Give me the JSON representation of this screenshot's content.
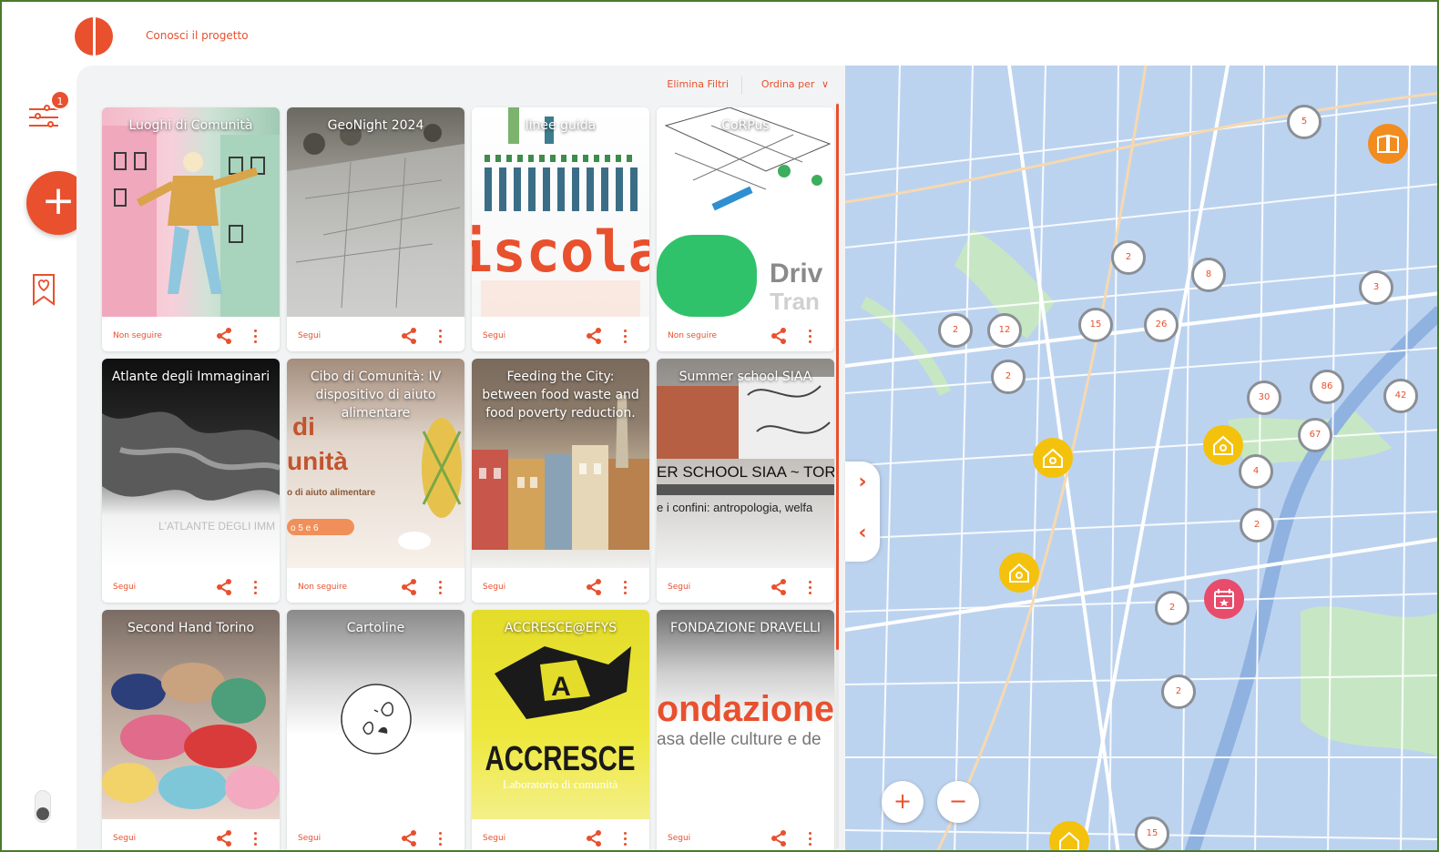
{
  "header": {
    "nav_link": "Conosci il progetto"
  },
  "rail": {
    "filter_badge": "1",
    "add_label": "+"
  },
  "toolbar": {
    "clear_filters": "Elimina Filtri",
    "sort_label": "Ordina per",
    "sort_chevron": "∨"
  },
  "cards": [
    {
      "title": "Luoghi di Comunità",
      "follow": "Non seguire"
    },
    {
      "title": "GeoNight 2024",
      "follow": "Segui"
    },
    {
      "title": "linee guida",
      "follow": "Segui"
    },
    {
      "title": "CoRPus",
      "follow": "Non seguire"
    },
    {
      "title": "Atlante degli Immaginari",
      "follow": "Segui"
    },
    {
      "title": "Cibo di Comunità: IV dispositivo di aiuto alimentare",
      "follow": "Non seguire"
    },
    {
      "title": "Feeding the City: between food waste and food poverty reduction.",
      "follow": "Segui"
    },
    {
      "title": "Summer school SIAA",
      "follow": "Segui"
    },
    {
      "title": "Second Hand Torino",
      "follow": "Segui"
    },
    {
      "title": "Cartoline",
      "follow": "Segui"
    },
    {
      "title": "ACCRESCE@EFYS",
      "follow": "Segui"
    },
    {
      "title": "FONDAZIONE DRAVELLI",
      "follow": "Segui"
    }
  ],
  "card_image_text": {
    "iscola": "iscola",
    "drive": "Driv",
    "drive_sub": "Tran",
    "atlante": "L'ATLANTE DEGLI IMM",
    "cibo_big1": "di",
    "cibo_big2": "unità",
    "cibo_small": "o di aiuto alimentare",
    "cibo_pill": "o 5 e 6",
    "siaa_big": "ER SCHOOL SIAA ~ TORII",
    "siaa_small": "e i confini: antropologia, welfa",
    "accresce_big": "ACCRESCE",
    "accresce_small": "Laboratorio di comunità",
    "accresce_letter": "A",
    "fond_big": "ondazione",
    "fond_small": "asa delle culture e de"
  },
  "map": {
    "clusters": [
      "5",
      "2",
      "8",
      "3",
      "2",
      "12",
      "15",
      "26",
      "2",
      "30",
      "86",
      "42",
      "67",
      "4",
      "2",
      "2",
      "2",
      "15"
    ],
    "zoom_in": "+",
    "zoom_out": "−",
    "collapse_right": "›",
    "collapse_left": "‹"
  },
  "colors": {
    "accent": "#e8502e",
    "map_water": "#bcd3ef",
    "pin_yellow": "#f4c20d",
    "pin_red": "#e94b6b",
    "pin_orange": "#f28c1e"
  },
  "icons": [
    "filter-icon",
    "bookmark-heart-icon",
    "share-icon",
    "more-vertical-icon",
    "chevron-down-icon",
    "home-pin-icon",
    "calendar-pin-icon",
    "book-pin-icon"
  ]
}
